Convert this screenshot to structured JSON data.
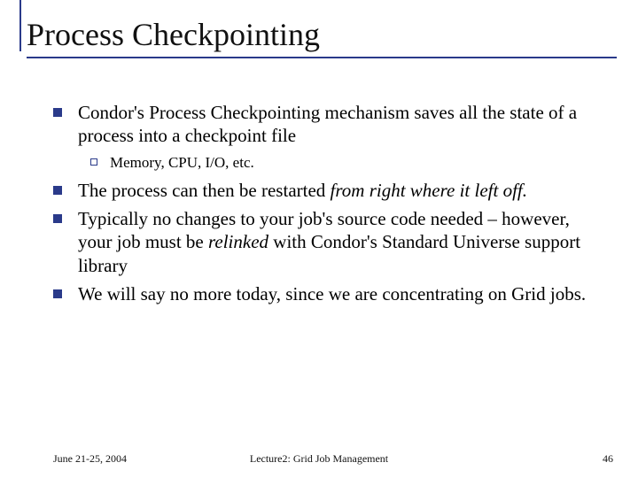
{
  "title": "Process Checkpointing",
  "bullets": {
    "b1": "Condor's Process Checkpointing mechanism saves all the state of a process into a checkpoint file",
    "b1a": "Memory, CPU, I/O, etc.",
    "b2_pre": "The process can then be restarted ",
    "b2_it": "from right where it left off.",
    "b3_a": "Typically no changes to your job's source code needed – however, your job must be ",
    "b3_it": "relinked",
    "b3_b": " with Condor's Standard Universe support library",
    "b4": "We will say no more today, since we are concentrating on Grid jobs."
  },
  "footer": {
    "date": "June 21-25, 2004",
    "center": "Lecture2: Grid Job Management",
    "page": "46"
  }
}
